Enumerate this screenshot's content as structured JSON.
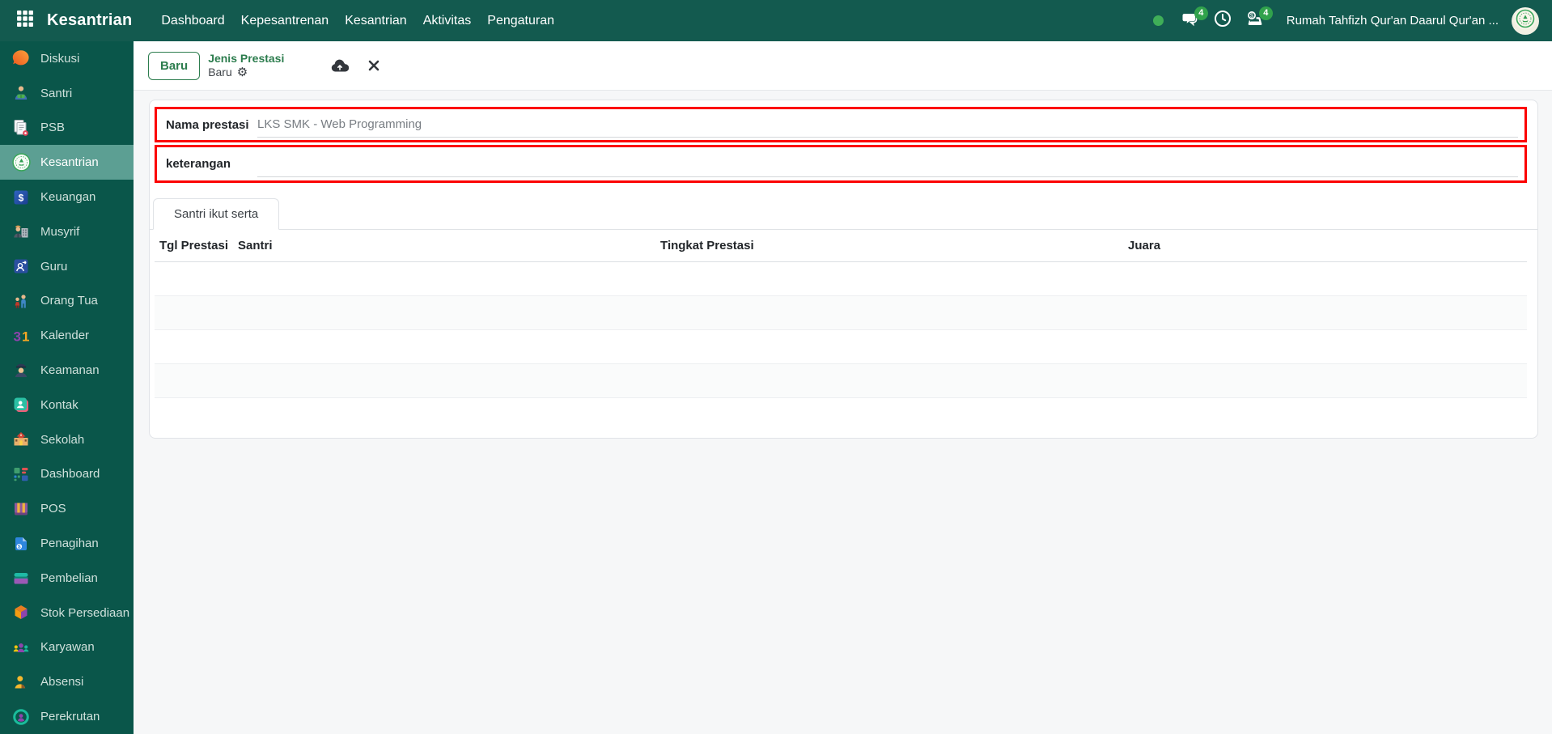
{
  "topbar": {
    "brand": "Kesantrian",
    "menus": [
      {
        "label": "Dashboard"
      },
      {
        "label": "Kepesantrenan"
      },
      {
        "label": "Kesantrian"
      },
      {
        "label": "Aktivitas"
      },
      {
        "label": "Pengaturan"
      }
    ],
    "chat_badge": "4",
    "activity_badge": "4",
    "company": "Rumah Tahfizh Qur'an Daarul Qur'an ..."
  },
  "sidebar": {
    "items": [
      {
        "label": "Diskusi",
        "icon": "chat-bubble-icon"
      },
      {
        "label": "Santri",
        "icon": "student-icon"
      },
      {
        "label": "PSB",
        "icon": "documents-icon"
      },
      {
        "label": "Kesantrian",
        "icon": "pesantren-logo-icon",
        "active": true
      },
      {
        "label": "Keuangan",
        "icon": "dollar-square-icon"
      },
      {
        "label": "Musyrif",
        "icon": "supervisor-icon"
      },
      {
        "label": "Guru",
        "icon": "teacher-icon"
      },
      {
        "label": "Orang Tua",
        "icon": "parents-icon"
      },
      {
        "label": "Kalender",
        "icon": "calendar-31-icon"
      },
      {
        "label": "Keamanan",
        "icon": "security-guard-icon"
      },
      {
        "label": "Kontak",
        "icon": "contact-icon"
      },
      {
        "label": "Sekolah",
        "icon": "school-building-icon"
      },
      {
        "label": "Dashboard",
        "icon": "dashboard-tiles-icon"
      },
      {
        "label": "POS",
        "icon": "pos-awning-icon"
      },
      {
        "label": "Penagihan",
        "icon": "invoice-icon"
      },
      {
        "label": "Pembelian",
        "icon": "purchase-icon"
      },
      {
        "label": "Stok Persediaan",
        "icon": "inventory-cube-icon"
      },
      {
        "label": "Karyawan",
        "icon": "employees-icon"
      },
      {
        "label": "Absensi",
        "icon": "attendance-icon"
      },
      {
        "label": "Perekrutan",
        "icon": "recruitment-icon"
      }
    ]
  },
  "control_panel": {
    "new_button": "Baru",
    "breadcrumb_model": "Jenis Prestasi",
    "breadcrumb_record": "Baru"
  },
  "form": {
    "fields": [
      {
        "label": "Nama prestasi",
        "value": "LKS SMK - Web Programming"
      },
      {
        "label": "keterangan",
        "value": ""
      }
    ],
    "tabs": [
      {
        "label": "Santri ikut serta",
        "active": true
      }
    ],
    "table": {
      "headers": [
        "Tgl Prestasi",
        "Santri",
        "Tingkat Prestasi",
        "Juara"
      ],
      "rows": [
        [],
        [],
        [],
        []
      ]
    }
  },
  "colors": {
    "topbar_bg": "#135a4f",
    "sidebar_bg": "#0a564a",
    "sidebar_active_bg": "#5c9f93",
    "accent_green": "#2d7d4e",
    "badge_green": "#31a24c",
    "status_dot_green": "#3fae58",
    "field_highlight_border": "#fc0000",
    "content_bg": "#f6f7f8"
  }
}
